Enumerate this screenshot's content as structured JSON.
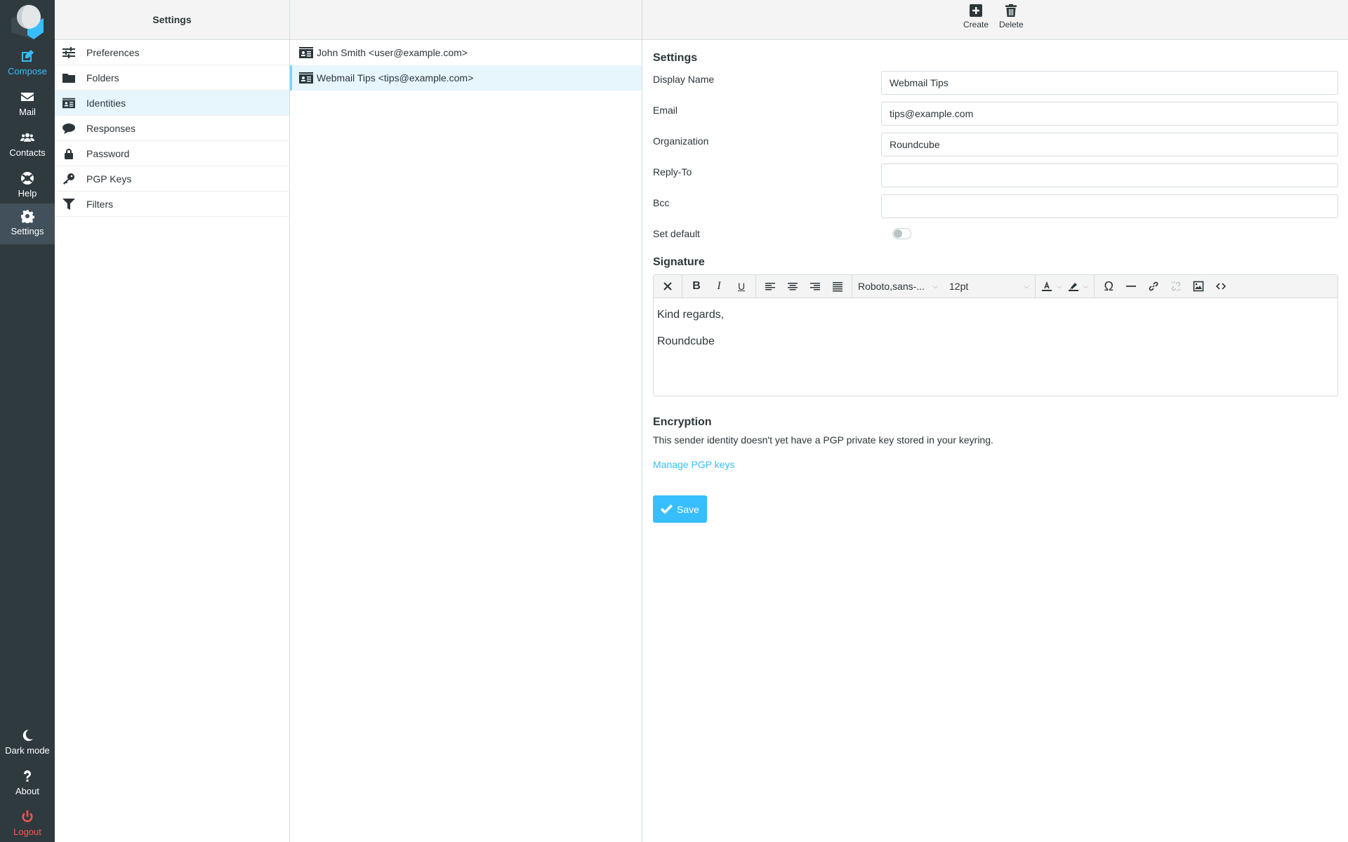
{
  "nav": {
    "items": [
      {
        "id": "compose",
        "label": "Compose",
        "icon": "compose-icon"
      },
      {
        "id": "mail",
        "label": "Mail",
        "icon": "envelope-icon"
      },
      {
        "id": "contacts",
        "label": "Contacts",
        "icon": "users-icon"
      },
      {
        "id": "help",
        "label": "Help",
        "icon": "lifebuoy-icon"
      },
      {
        "id": "settings",
        "label": "Settings",
        "icon": "gear-icon"
      }
    ],
    "bottom": [
      {
        "id": "darkmode",
        "label": "Dark mode",
        "icon": "moon-icon"
      },
      {
        "id": "about",
        "label": "About",
        "icon": "question-icon"
      },
      {
        "id": "logout",
        "label": "Logout",
        "icon": "power-icon"
      }
    ]
  },
  "settings_panel": {
    "title": "Settings",
    "items": [
      {
        "label": "Preferences",
        "icon": "sliders-icon"
      },
      {
        "label": "Folders",
        "icon": "folder-icon"
      },
      {
        "label": "Identities",
        "icon": "id-card-icon",
        "selected": true
      },
      {
        "label": "Responses",
        "icon": "comment-icon"
      },
      {
        "label": "Password",
        "icon": "lock-icon"
      },
      {
        "label": "PGP Keys",
        "icon": "key-icon"
      },
      {
        "label": "Filters",
        "icon": "filter-icon"
      }
    ]
  },
  "identities": [
    {
      "label": "John Smith <user@example.com>"
    },
    {
      "label": "Webmail Tips <tips@example.com>",
      "selected": true
    }
  ],
  "toolbar": {
    "create_label": "Create",
    "delete_label": "Delete"
  },
  "form": {
    "settings_heading": "Settings",
    "fields": {
      "display_name": {
        "label": "Display Name",
        "value": "Webmail Tips"
      },
      "email": {
        "label": "Email",
        "value": "tips@example.com"
      },
      "organization": {
        "label": "Organization",
        "value": "Roundcube"
      },
      "reply_to": {
        "label": "Reply-To",
        "value": ""
      },
      "bcc": {
        "label": "Bcc",
        "value": ""
      },
      "set_default": {
        "label": "Set default",
        "value": false
      }
    },
    "signature_heading": "Signature",
    "editor": {
      "font_family": "Roboto,sans-...",
      "font_size": "12pt",
      "lines": [
        "Kind regards,",
        "Roundcube"
      ]
    },
    "encryption_heading": "Encryption",
    "encryption_text": "This sender identity doesn't yet have a PGP private key stored in your keyring.",
    "manage_link": "Manage PGP keys",
    "save_label": "Save"
  },
  "colors": {
    "accent": "#37beff",
    "nav_bg": "#2f3a3f",
    "selected_bg": "#e7f6fd",
    "logout": "#ff5552"
  }
}
